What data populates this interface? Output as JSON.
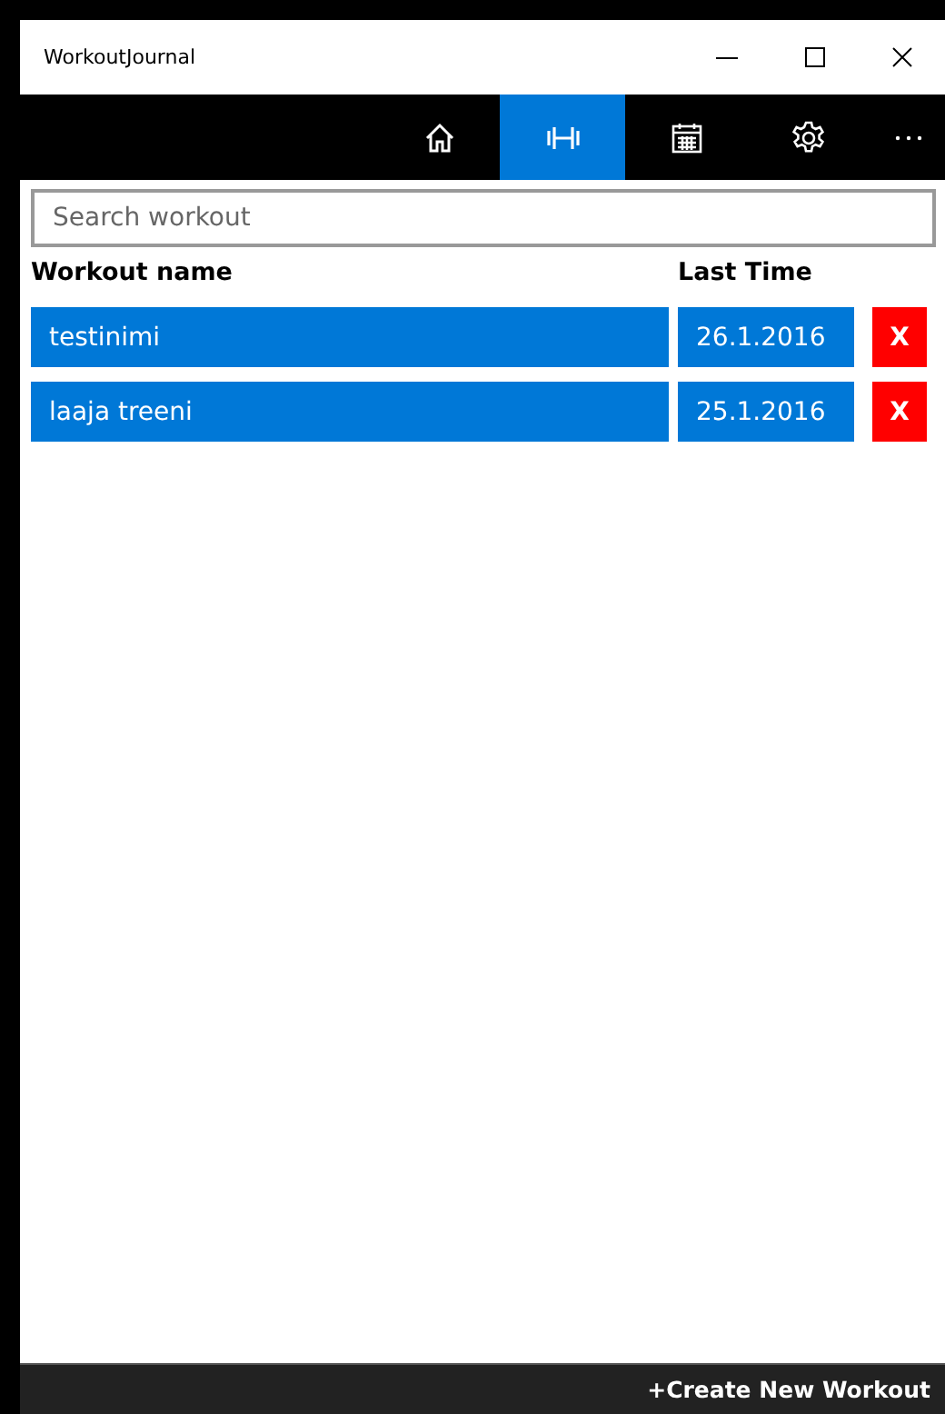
{
  "window": {
    "title": "WorkoutJournal"
  },
  "tabs": [
    {
      "kind": "home",
      "selected": false
    },
    {
      "kind": "dumbbell",
      "selected": true
    },
    {
      "kind": "calendar",
      "selected": false
    },
    {
      "kind": "settings",
      "selected": false
    },
    {
      "kind": "more",
      "selected": false
    }
  ],
  "search": {
    "placeholder": "Search workout"
  },
  "table": {
    "columns": [
      "Workout name",
      "Last Time"
    ],
    "rows": [
      {
        "name": "testinimi",
        "last_time": "26.1.2016",
        "delete": "X"
      },
      {
        "name": "laaja treeni",
        "last_time": "25.1.2016",
        "delete": "X"
      }
    ]
  },
  "bottom_bar": {
    "action": "+Create New Workout"
  }
}
